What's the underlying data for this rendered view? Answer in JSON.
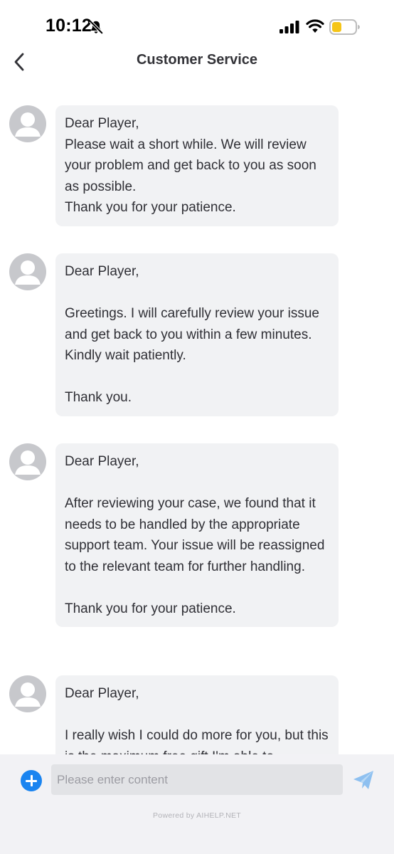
{
  "status_bar": {
    "time": "10:12",
    "icons": [
      "bell-slash-icon",
      "cellular-signal-icon",
      "wifi-icon",
      "battery-low-icon"
    ],
    "battery_color": "#f5c518"
  },
  "nav": {
    "title": "Customer Service",
    "back_icon": "chevron-left-icon"
  },
  "messages": [
    {
      "sender": "agent",
      "avatar_icon": "user-avatar-icon",
      "text": "Dear Player,\nPlease wait a short while. We will review your problem and get back to you as soon as possible.\nThank you for your patience."
    },
    {
      "sender": "agent",
      "avatar_icon": "user-avatar-icon",
      "text": "Dear Player,\n\nGreetings. I will carefully review your issue and get back to you within a few minutes. Kindly wait patiently.\n\nThank you."
    },
    {
      "sender": "agent",
      "avatar_icon": "user-avatar-icon",
      "text": "Dear Player,\n\nAfter reviewing your case, we found that it needs to be handled by the appropriate support team. Your issue will be reassigned to the relevant team for further handling.\n\nThank you for your patience."
    },
    {
      "sender": "agent",
      "avatar_icon": "user-avatar-icon",
      "text": "Dear Player,\n\nI really wish I could do more for you, but this is the maximum free gift I'm able to"
    }
  ],
  "composer": {
    "placeholder": "Please enter content",
    "value": "",
    "add_icon": "plus-circle-icon",
    "send_icon": "send-paper-plane-icon"
  },
  "footer": {
    "powered_by": "Powered by AIHELP.NET"
  },
  "colors": {
    "accent": "#1a84f0",
    "send_icon": "#8ec0f0",
    "bubble_bg": "#f1f2f4",
    "avatar_bg": "#c7c8cc"
  }
}
